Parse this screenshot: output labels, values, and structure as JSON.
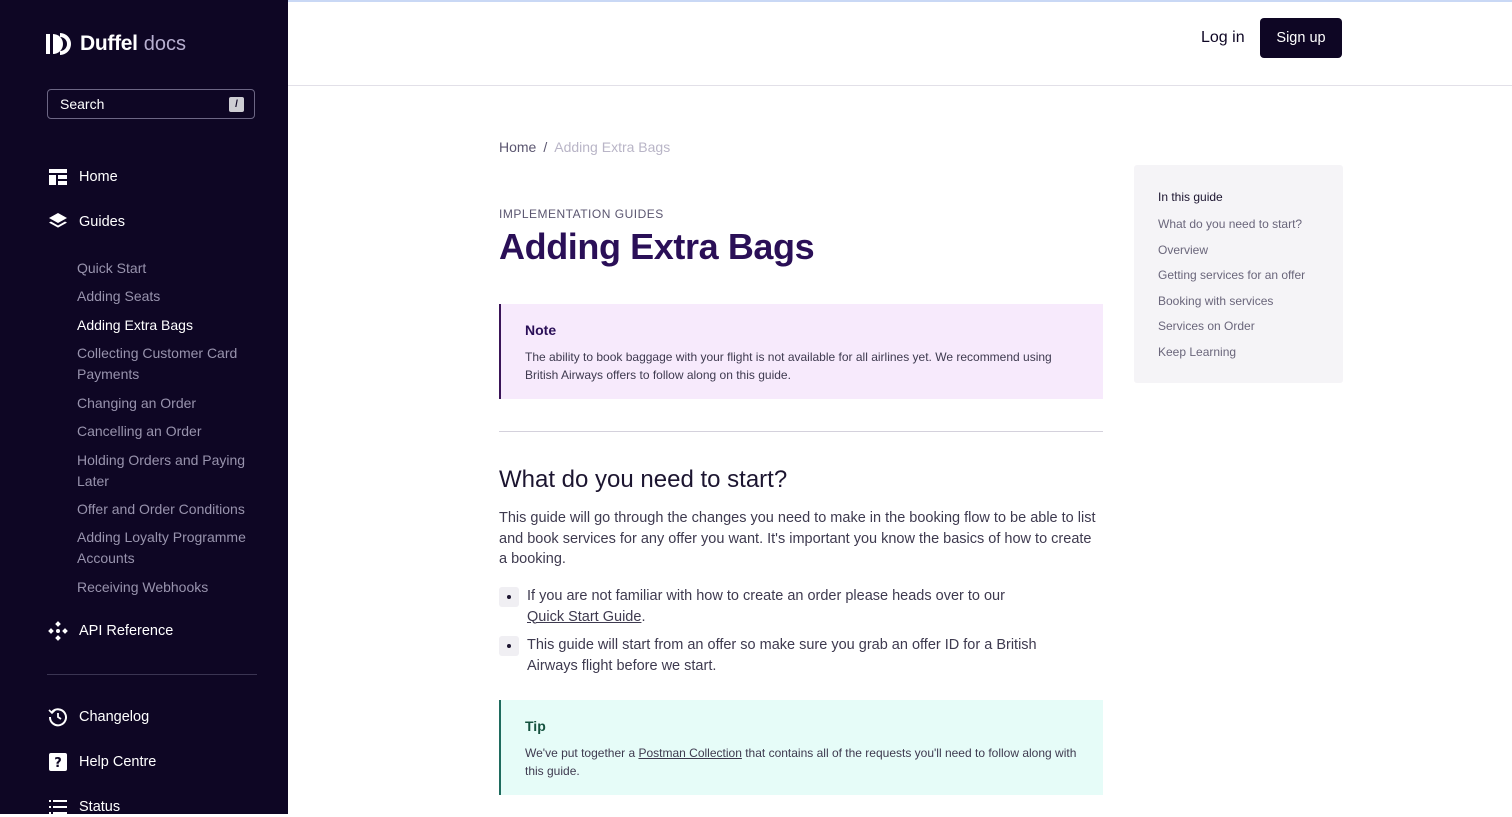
{
  "sidebar": {
    "brand": "Duffel",
    "brand_suffix": "docs",
    "search": {
      "label": "Search",
      "shortcut": "/"
    },
    "nav": {
      "home": "Home",
      "guides": "Guides",
      "api_reference": "API Reference",
      "changelog": "Changelog",
      "help_centre": "Help Centre",
      "status": "Status"
    },
    "guides_items": [
      "Quick Start",
      "Adding Seats",
      "Adding Extra Bags",
      "Collecting Customer Card Payments",
      "Changing an Order",
      "Cancelling an Order",
      "Holding Orders and Paying Later",
      "Offer and Order Conditions",
      "Adding Loyalty Programme Accounts",
      "Receiving Webhooks"
    ],
    "active_item": "Adding Extra Bags"
  },
  "header": {
    "login": "Log in",
    "signup": "Sign up"
  },
  "breadcrumb": {
    "home": "Home",
    "separator": "/",
    "current": "Adding Extra Bags"
  },
  "page": {
    "eyebrow": "IMPLEMENTATION GUIDES",
    "title": "Adding Extra Bags",
    "note": {
      "heading": "Note",
      "text": "The ability to book baggage with your flight is not available for all airlines yet. We recommend using British Airways offers to follow along on this guide."
    },
    "section_title": "What do you need to start?",
    "intro": "This guide will go through the changes you need to make in the booking flow to be able to list and book services for any offer you want. It's important you know the basics of how to create a booking.",
    "bullet1_text": "If you are not familiar with how to create an order please heads over to our",
    "bullet1_link": "Quick Start Guide",
    "bullet1_end": ".",
    "bullet2_text": "This guide will start from an offer so make sure you grab an offer ID for a British Airways flight before we start.",
    "tip": {
      "heading": "Tip",
      "text_before": "We've put together a",
      "link": "Postman Collection",
      "text_after": "that contains all of the requests you'll need to follow along with this guide."
    }
  },
  "toc": {
    "heading": "In this guide",
    "items": [
      "What do you need to start?",
      "Overview",
      "Getting services for an offer",
      "Booking with services",
      "Services on Order",
      "Keep Learning"
    ]
  },
  "colors": {
    "sidebar_bg": "#0e0624",
    "title": "#2a0f57",
    "note_bg": "#f7eafc",
    "tip_bg": "#e6fcf8",
    "signup_bg": "#0e0624"
  }
}
